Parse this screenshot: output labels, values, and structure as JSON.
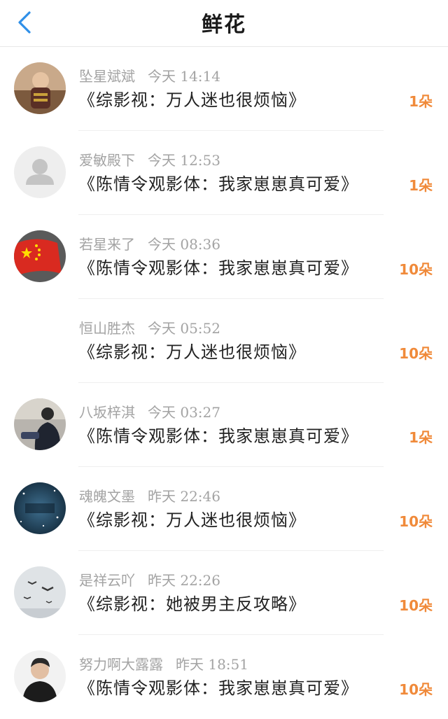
{
  "header": {
    "title": "鲜花",
    "back_icon": "chevron-left-icon",
    "accent_color": "#2f8fe8"
  },
  "rows": [
    {
      "user": "坠星斌斌",
      "time": "今天 14:14",
      "work": "《综影视：万人迷也很烦恼》",
      "count": "1朵",
      "avatar": "photo"
    },
    {
      "user": "爱敏殿下",
      "time": "今天 12:53",
      "work": "《陈情令观影体：我家崽崽真可爱》",
      "count": "1朵",
      "avatar": "default-user"
    },
    {
      "user": "若星来了",
      "time": "今天 08:36",
      "work": "《陈情令观影体：我家崽崽真可爱》",
      "count": "10朵",
      "avatar": "flag"
    },
    {
      "user": "恒山胜杰",
      "time": "今天 05:52",
      "work": "《综影视：万人迷也很烦恼》",
      "count": "10朵",
      "avatar": "none"
    },
    {
      "user": "八坂梓淇",
      "time": "今天 03:27",
      "work": "《陈情令观影体：我家崽崽真可爱》",
      "count": "1朵",
      "avatar": "photo"
    },
    {
      "user": "魂魄文墨",
      "time": "昨天 22:46",
      "work": "《综影视：万人迷也很烦恼》",
      "count": "10朵",
      "avatar": "starry"
    },
    {
      "user": "是祥云吖",
      "time": "昨天 22:26",
      "work": "《综影视：她被男主反攻略》",
      "count": "10朵",
      "avatar": "birds"
    },
    {
      "user": "努力啊大露露",
      "time": "昨天 18:51",
      "work": "《陈情令观影体：我家崽崽真可爱》",
      "count": "10朵",
      "avatar": "portrait"
    }
  ],
  "colors": {
    "count": "#f08a3a",
    "meta": "#a3a3a3",
    "work": "#222222"
  }
}
